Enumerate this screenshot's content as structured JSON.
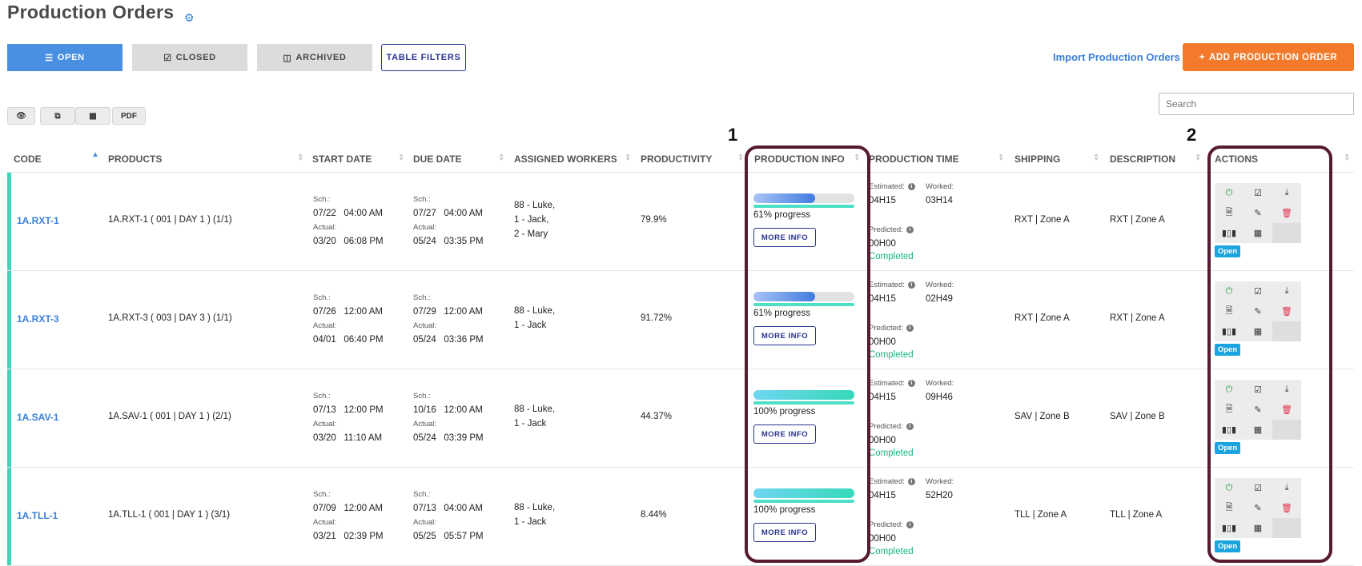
{
  "page": {
    "title": "Production Orders",
    "title_icon": "gear-icon"
  },
  "tabs": {
    "open": "OPEN",
    "closed": "CLOSED",
    "archived": "ARCHIVED",
    "filters": "TABLE FILTERS"
  },
  "actions_bar": {
    "import": "Import Production Orders",
    "add": "ADD PRODUCTION ORDER",
    "add_icon": "plus-icon"
  },
  "search": {
    "placeholder": "Search"
  },
  "toolbar": {
    "pdf": "PDF"
  },
  "callouts": {
    "one": "1",
    "two": "2"
  },
  "columns": {
    "code": "CODE",
    "products": "PRODUCTS",
    "start_date": "START DATE",
    "due_date": "DUE DATE",
    "workers": "ASSIGNED WORKERS",
    "productivity": "PRODUCTIVITY",
    "production_info": "PRODUCTION INFO",
    "production_time": "PRODUCTION TIME",
    "shipping": "SHIPPING",
    "description": "DESCRIPTION",
    "actions": "ACTIONS"
  },
  "labels": {
    "sch": "Sch.:",
    "actual": "Actual:",
    "estimated": "Estimated:",
    "worked": "Worked:",
    "predicted": "Predicted:",
    "more_info": "MORE INFO",
    "open_badge": "Open"
  },
  "colors": {
    "accent": "#4a90e2",
    "orange": "#f47a2b",
    "teal": "#3cd6b5",
    "navy": "#2a3394",
    "highlight": "#561a32",
    "completed": "#14b87a"
  },
  "rows": [
    {
      "code": "1A.RXT-1",
      "product": "1A.RXT-1 ( 001 | DAY 1 ) (1/1)",
      "start_sch": "07/22   04:00 AM",
      "start_actual": "03/20   06:08 PM",
      "due_sch": "07/27   04:00 AM",
      "due_actual": "05/24   03:35 PM",
      "workers": [
        "88 - Luke,",
        "1 - Jack,",
        "2 - Mary"
      ],
      "productivity": "79.9%",
      "progress": 0.61,
      "progress_label": "61% progress",
      "estimated": "04H15",
      "worked": "03H14",
      "predicted": "00H00",
      "status": "Completed",
      "shipping": "RXT | Zone A",
      "description": "RXT | Zone A"
    },
    {
      "code": "1A.RXT-3",
      "product": "1A.RXT-3 ( 003 | DAY 3 ) (1/1)",
      "start_sch": "07/26   12:00 AM",
      "start_actual": "04/01   06:40 PM",
      "due_sch": "07/29   12:00 AM",
      "due_actual": "05/24   03:36 PM",
      "workers": [
        "88 - Luke,",
        "1 - Jack"
      ],
      "productivity": "91.72%",
      "progress": 0.61,
      "progress_label": "61% progress",
      "estimated": "04H15",
      "worked": "02H49",
      "predicted": "00H00",
      "status": "Completed",
      "shipping": "RXT | Zone A",
      "description": "RXT | Zone A"
    },
    {
      "code": "1A.SAV-1",
      "product": "1A.SAV-1 ( 001 | DAY 1 ) (2/1)",
      "start_sch": "07/13   12:00 PM",
      "start_actual": "03/20   11:10 AM",
      "due_sch": "10/16   12:00 AM",
      "due_actual": "05/24   03:39 PM",
      "workers": [
        "88 - Luke,",
        "1 - Jack"
      ],
      "productivity": "44.37%",
      "progress": 1.0,
      "progress_label": "100% progress",
      "estimated": "04H15",
      "worked": "09H46",
      "predicted": "00H00",
      "status": "Completed",
      "shipping": "SAV | Zone B",
      "description": "SAV | Zone B"
    },
    {
      "code": "1A.TLL-1",
      "product": "1A.TLL-1 ( 001 | DAY 1 ) (3/1)",
      "start_sch": "07/09   12:00 AM",
      "start_actual": "03/21   02:39 PM",
      "due_sch": "07/13   04:00 AM",
      "due_actual": "05/25   05:57 PM",
      "workers": [
        "88 - Luke,",
        "1 - Jack"
      ],
      "productivity": "8.44%",
      "progress": 1.0,
      "progress_label": "100% progress",
      "estimated": "04H15",
      "worked": "52H20",
      "predicted": "00H00",
      "status": "Completed",
      "shipping": "TLL | Zone A",
      "description": "TLL | Zone A"
    }
  ]
}
